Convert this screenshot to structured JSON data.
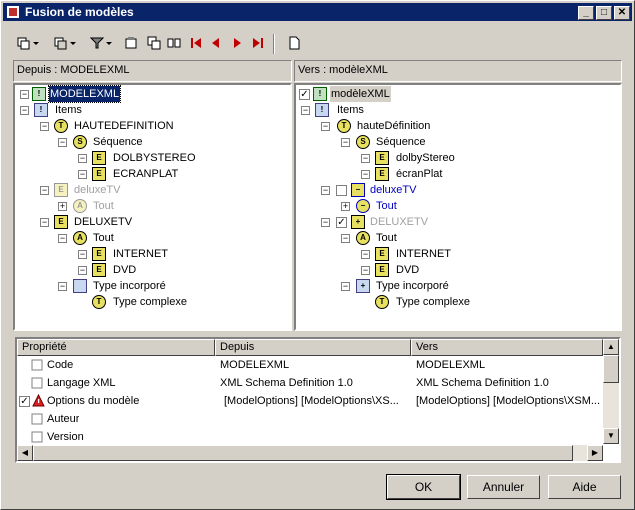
{
  "window": {
    "title": "Fusion de modèles"
  },
  "left_panel": {
    "header": "Depuis : MODELEXML",
    "nodes": [
      {
        "label": "MODELEXML"
      },
      {
        "label": "Items"
      },
      {
        "label": "HAUTEDEFINITION"
      },
      {
        "label": "Séquence"
      },
      {
        "label": "DOLBYSTEREO"
      },
      {
        "label": "ECRANPLAT"
      },
      {
        "label": "deluxeTV"
      },
      {
        "label": "Tout"
      },
      {
        "label": "DELUXETV"
      },
      {
        "label": "Tout"
      },
      {
        "label": "INTERNET"
      },
      {
        "label": "DVD"
      },
      {
        "label": "Type incorporé"
      },
      {
        "label": "Type complexe"
      }
    ]
  },
  "right_panel": {
    "header": "Vers : modèleXML",
    "nodes": [
      {
        "label": "modèleXML"
      },
      {
        "label": "Items"
      },
      {
        "label": "hauteDéfinition"
      },
      {
        "label": "Séquence"
      },
      {
        "label": "dolbyStereo"
      },
      {
        "label": "écranPlat"
      },
      {
        "label": "deluxeTV"
      },
      {
        "label": "Tout"
      },
      {
        "label": "DELUXETV"
      },
      {
        "label": "Tout"
      },
      {
        "label": "INTERNET"
      },
      {
        "label": "DVD"
      },
      {
        "label": "Type incorporé"
      },
      {
        "label": "Type complexe"
      }
    ]
  },
  "grid": {
    "columns": [
      "Propriété",
      "Depuis",
      "Vers"
    ],
    "rows": [
      {
        "prop": "Code",
        "from": "MODELEXML",
        "to": "MODELEXML"
      },
      {
        "prop": "Langage XML",
        "from": "XML Schema Definition 1.0",
        "to": "XML Schema Definition 1.0"
      },
      {
        "prop": "Options du modèle",
        "from": "[ModelOptions]  [ModelOptions\\XS...",
        "to": "[ModelOptions]  [ModelOptions\\XSM..."
      },
      {
        "prop": "Auteur",
        "from": "",
        "to": ""
      },
      {
        "prop": "Version",
        "from": "",
        "to": ""
      }
    ]
  },
  "buttons": {
    "ok": "OK",
    "cancel": "Annuler",
    "help": "Aide"
  },
  "colors": {
    "titlebar": "#0a246a",
    "face": "#d4d0c8",
    "selection": "#0a246a",
    "nav_arrow": "#c00000"
  }
}
